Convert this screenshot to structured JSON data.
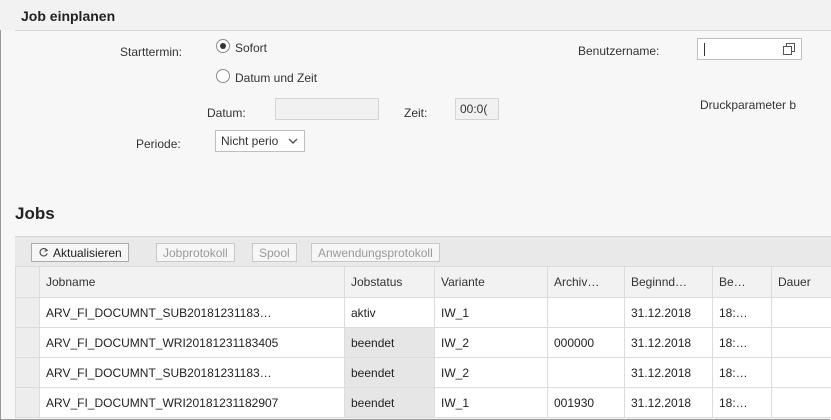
{
  "section": {
    "title": "Job einplanen"
  },
  "form": {
    "starttermin_label": "Starttermin:",
    "radio_sofort": "Sofort",
    "radio_datum_zeit": "Datum und Zeit",
    "datum_label": "Datum:",
    "datum_value": "",
    "zeit_label": "Zeit:",
    "zeit_value": "00:0(",
    "periode_label": "Periode:",
    "periode_value": "Nicht perio",
    "benutzername_label": "Benutzername:",
    "benutzername_value": "",
    "druckparameter_label": "Druckparameter b"
  },
  "jobs": {
    "title": "Jobs",
    "toolbar": {
      "refresh": "Aktualisieren",
      "jobprotokoll": "Jobprotokoll",
      "spool": "Spool",
      "anwendungsprotokoll": "Anwendungsprotokoll"
    },
    "columns": [
      "Jobname",
      "Jobstatus",
      "Variante",
      "Archiv…",
      "Beginnd…",
      "Be…",
      "Dauer"
    ],
    "rows": [
      {
        "jobname": "ARV_FI_DOCUMNT_SUB20181231183…",
        "status": "aktiv",
        "variante": "IW_1",
        "archiv": "",
        "datum": "31.12.2018",
        "zeit": "18:…",
        "dauer": ""
      },
      {
        "jobname": "ARV_FI_DOCUMNT_WRI20181231183405",
        "status": "beendet",
        "variante": "IW_2",
        "archiv": "000000",
        "datum": "31.12.2018",
        "zeit": "18:…",
        "dauer": ""
      },
      {
        "jobname": "ARV_FI_DOCUMNT_SUB20181231183…",
        "status": "beendet",
        "variante": "IW_2",
        "archiv": "",
        "datum": "31.12.2018",
        "zeit": "18:…",
        "dauer": ""
      },
      {
        "jobname": "ARV_FI_DOCUMNT_WRI20181231182907",
        "status": "beendet",
        "variante": "IW_1",
        "archiv": "001930",
        "datum": "31.12.2018",
        "zeit": "18:…",
        "dauer": ""
      }
    ]
  }
}
